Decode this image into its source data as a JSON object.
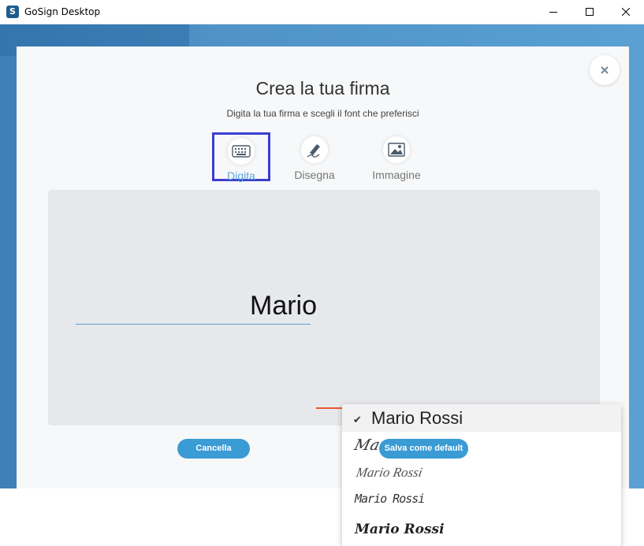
{
  "window": {
    "title": "GoSign Desktop",
    "app_icon_glyph": "S"
  },
  "dialog": {
    "heading": "Crea la tua firma",
    "subheading": "Digita la tua firma e scegli il font che preferisci",
    "tabs": [
      {
        "label": "Digita",
        "icon": "keyboard-icon",
        "active": true
      },
      {
        "label": "Disegna",
        "icon": "pen-icon",
        "active": false
      },
      {
        "label": "Immagine",
        "icon": "image-icon",
        "active": false
      }
    ],
    "signature_text": "Mario",
    "font_options": [
      {
        "label": "Mario Rossi",
        "selected": true
      },
      {
        "label": "Mario Rossi",
        "selected": false
      },
      {
        "label": "Mario Rossi",
        "selected": false
      },
      {
        "label": "Mario Rossi",
        "selected": false
      },
      {
        "label": "Mario Rossi",
        "selected": false
      }
    ],
    "check_glyph": "✔",
    "buttons": {
      "cancel": "Cancella",
      "save_default": "Salva come default"
    }
  },
  "colors": {
    "accent": "#3a9bd5",
    "active_tab_border": "#3c3ecf",
    "underline": "#e8592c"
  }
}
